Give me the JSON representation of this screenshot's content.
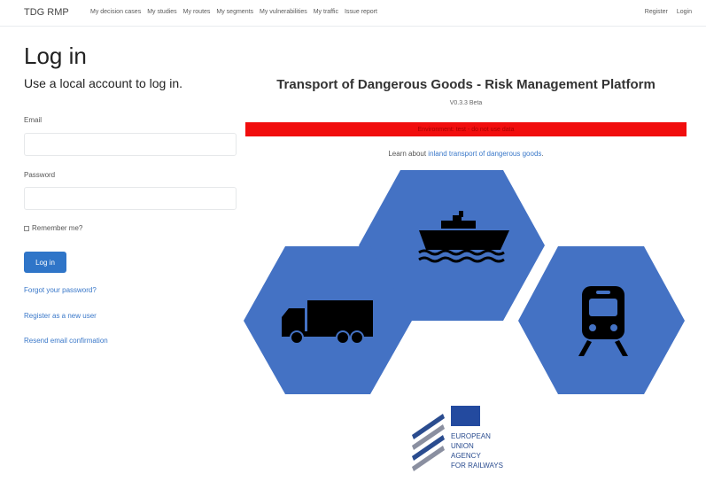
{
  "nav": {
    "brand": "TDG RMP",
    "links": [
      "My decision cases",
      "My studies",
      "My routes",
      "My segments",
      "My vulnerabilities",
      "My traffic",
      "Issue report"
    ],
    "register": "Register",
    "login": "Login"
  },
  "login": {
    "title": "Log in",
    "subtitle": "Use a local account to log in.",
    "email_label": "Email",
    "email_value": "",
    "password_label": "Password",
    "password_value": "",
    "remember_label": "Remember me?",
    "button_label": "Log in",
    "forgot_link": "Forgot your password?",
    "register_link": "Register as a new user",
    "resend_link": "Resend email confirmation"
  },
  "platform": {
    "title": "Transport of Dangerous Goods - Risk Management Platform",
    "version": "V0.3.3 Beta",
    "banner_text": "Environment: test - do not use data",
    "learn_prefix": "Learn about ",
    "learn_link": "inland transport of dangerous goods",
    "learn_suffix": ".",
    "hex_color": "#4472c4",
    "banner_color": "#f10d0d",
    "logo_lines": [
      "EUROPEAN",
      "UNION",
      "AGENCY",
      "FOR RAILWAYS"
    ]
  }
}
